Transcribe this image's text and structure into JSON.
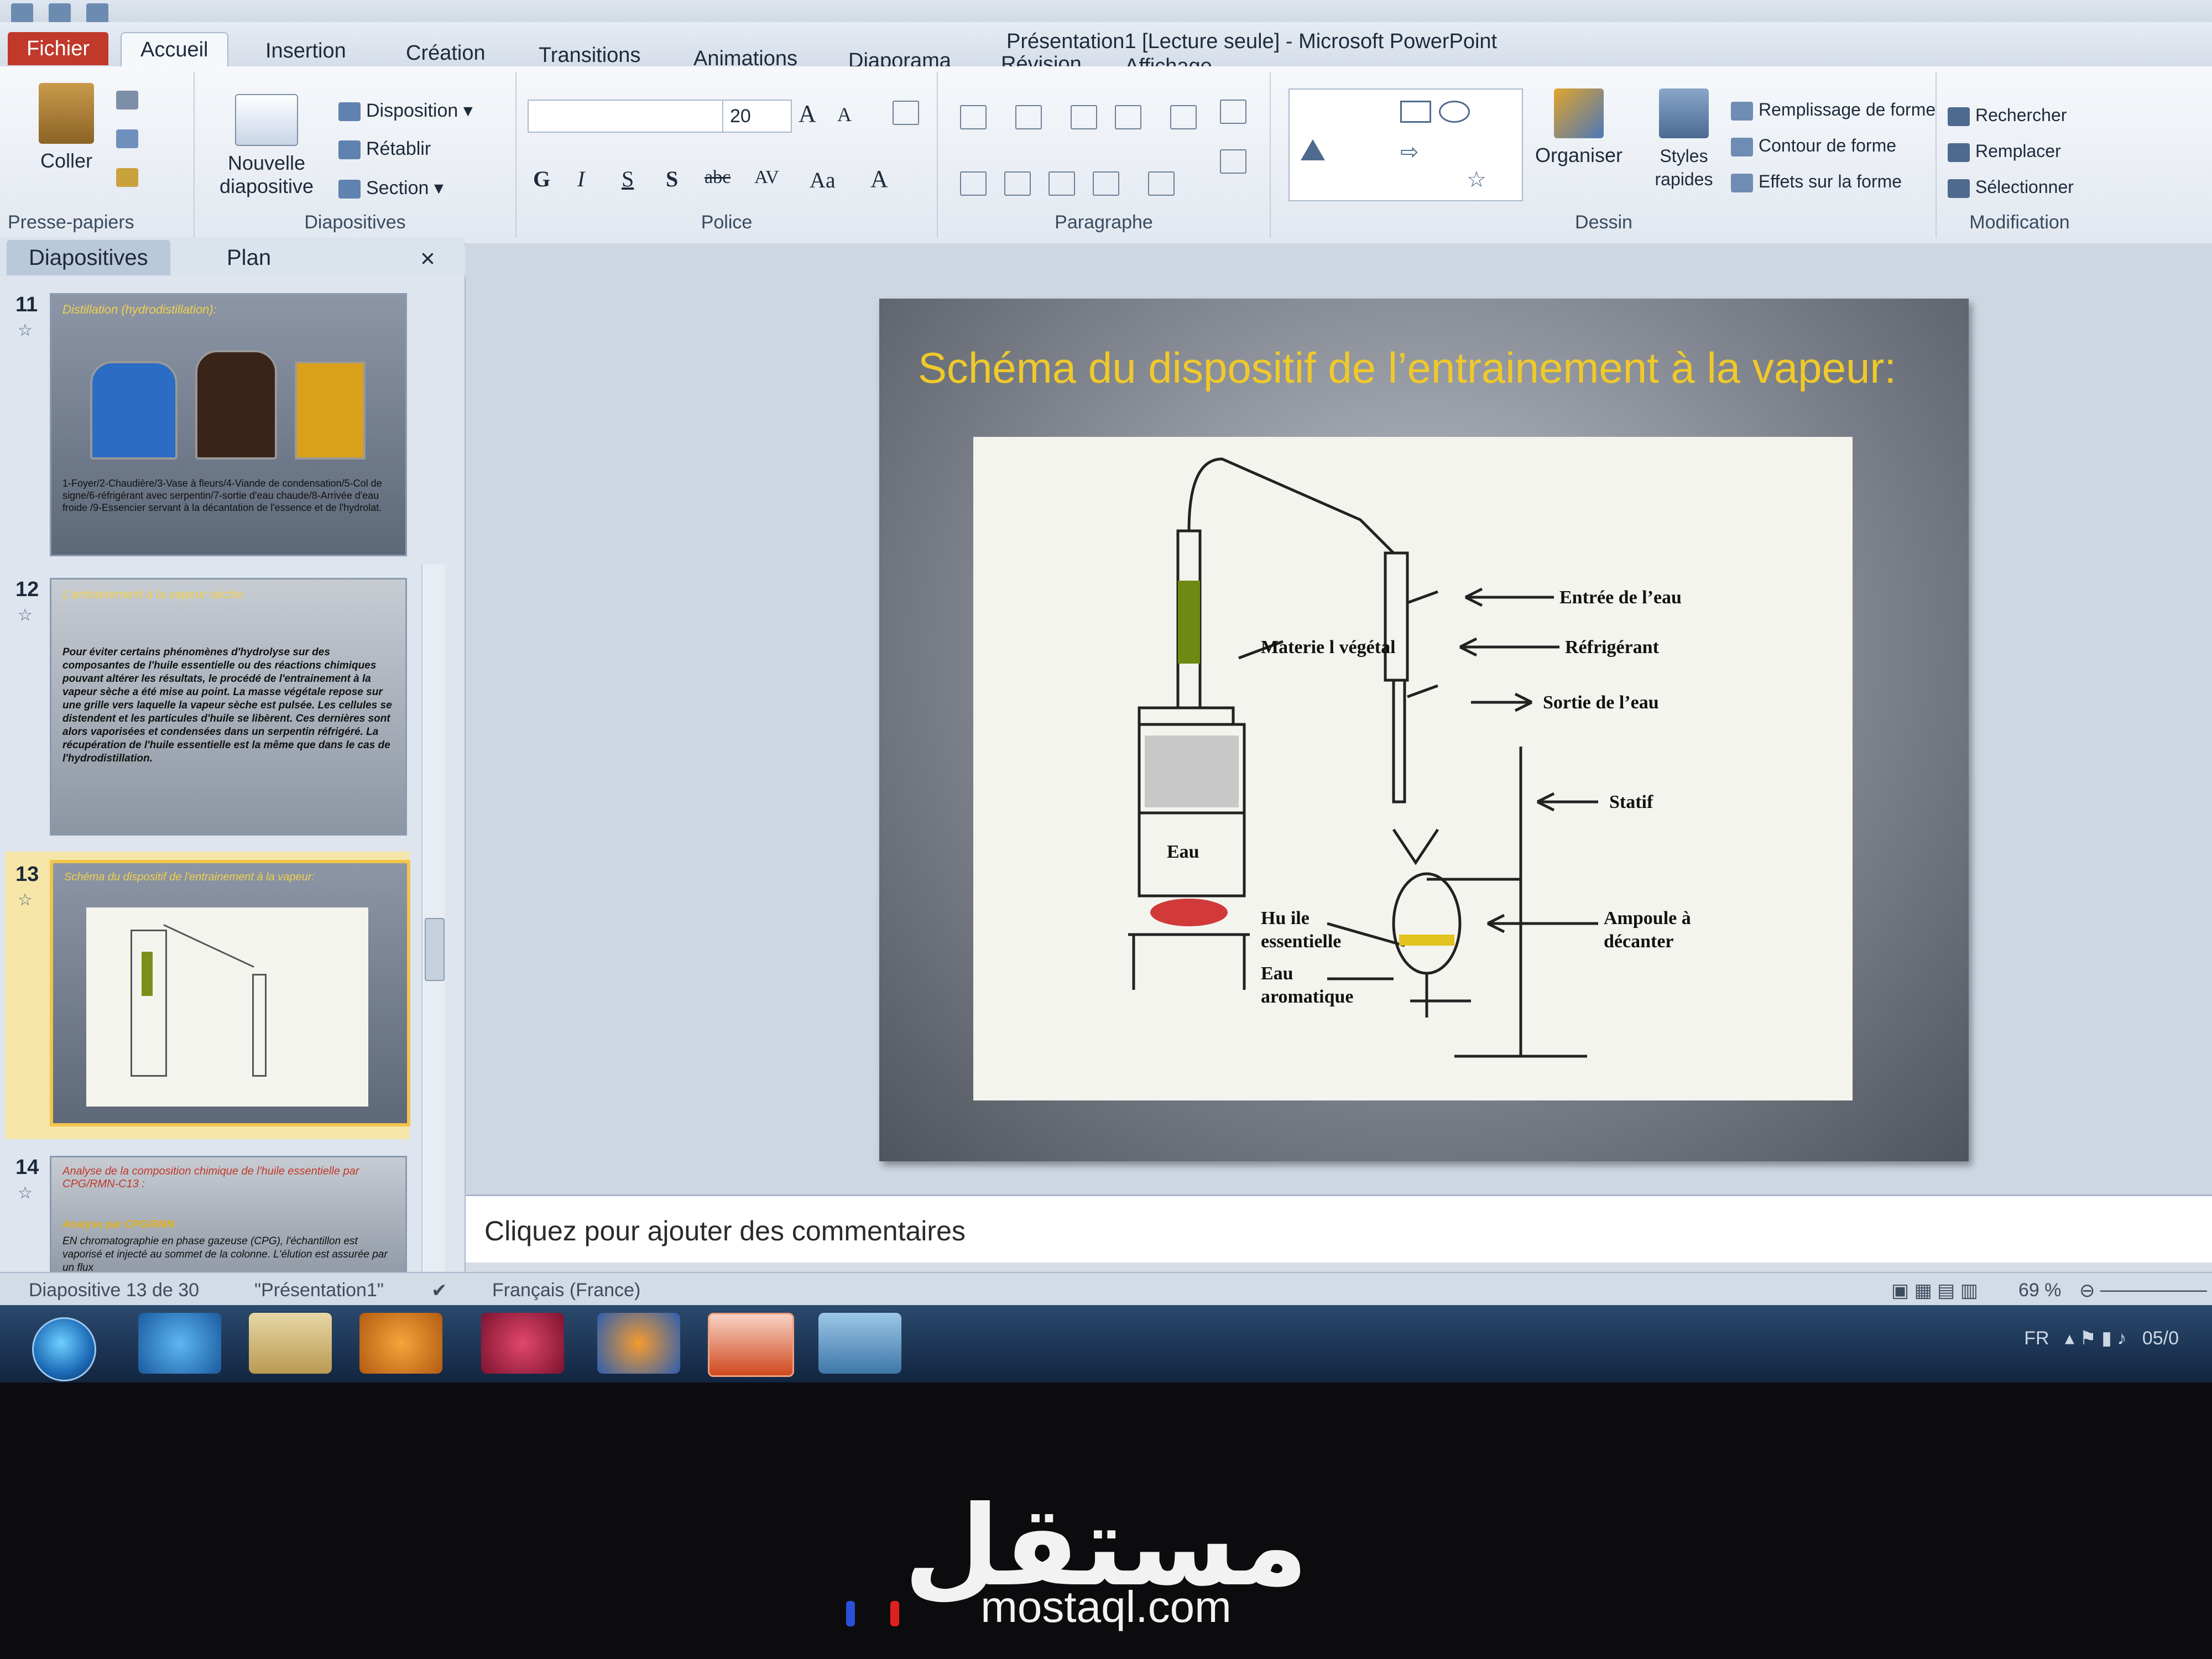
{
  "window": {
    "title": "Présentation1 [Lecture seule] - Microsoft PowerPoint"
  },
  "ribbon_tabs": [
    "Fichier",
    "Accueil",
    "Insertion",
    "Création",
    "Transitions",
    "Animations",
    "Diaporama",
    "Révision",
    "Affichage"
  ],
  "ribbon": {
    "clipboard": {
      "paste": "Coller",
      "label": "Presse-papiers"
    },
    "slides": {
      "new_slide": "Nouvelle diapositive",
      "layout": "Disposition",
      "reset": "Rétablir",
      "section": "Section",
      "label": "Diapositives"
    },
    "font": {
      "font_name": "",
      "font_size": "20",
      "bold": "G",
      "italic": "I",
      "underline": "S",
      "shadow": "S",
      "strike": "abc",
      "spacing": "AV",
      "case": "Aa",
      "color": "A",
      "label": "Police"
    },
    "paragraph": {
      "label": "Paragraphe"
    },
    "drawing": {
      "arrange": "Organiser",
      "quick_styles": "Styles rapides",
      "fill": "Remplissage de forme",
      "outline": "Contour de forme",
      "effects": "Effets sur la forme",
      "label": "Dessin"
    },
    "editing": {
      "find": "Rechercher",
      "replace": "Remplacer",
      "select": "Sélectionner",
      "label": "Modification"
    }
  },
  "pane": {
    "tabs": [
      "Diapositives",
      "Plan"
    ],
    "close": "×",
    "slides": [
      {
        "number": "11",
        "title": "Distillation (hydrodistillation):",
        "caption": "1-Foyer/2-Chaudière/3-Vase à fleurs/4-Viande de condensation/5-Col de signe/6-réfrigérant avec serpentin/7-sortie d'eau chaude/8-Arrivée d'eau froide /9-Essencier servant à la décantation de l'essence et de l'hydrolat."
      },
      {
        "number": "12",
        "title": "L'entrainement à la vapeur sèche:",
        "body": "Pour éviter certains phénomènes d'hydrolyse sur des composantes de l'huile essentielle ou des réactions chimiques pouvant altérer les résultats, le procédé de l'entrainement à la vapeur sèche a été mise au point. La masse végétale repose sur une grille vers laquelle la vapeur sèche est pulsée. Les cellules se distendent et les particules d'huile se libèrent. Ces dernières sont alors vaporisées et condensées dans un serpentin réfrigéré. La récupération de l'huile essentielle est la même que dans le cas de l'hydrodistillation."
      },
      {
        "number": "13",
        "title": "Schéma du dispositif de l'entrainement à la vapeur:"
      },
      {
        "number": "14",
        "title": "Analyse de la composition chimique de l'huile essentielle par CPG/RMN-C13 :",
        "subtitle": "Analyse par CPG/RMN",
        "body": "EN chromatographie en phase gazeuse (CPG), l'échantillon est vaporisé et injecté au sommet de la colonne. L'élution est assurée par un flux"
      }
    ]
  },
  "slide": {
    "title": "Schéma du dispositif de l’entrainement à la vapeur:",
    "labels": {
      "materiel": "Materie l végétal",
      "eau": "Eau",
      "entree": "Entrée de l’eau",
      "refrigerant": "Réfrigérant",
      "sortie": "Sortie de l’eau",
      "statif": "Statif",
      "huile": "Hu ile essentielle",
      "eau_aromatique": "Eau aromatique",
      "ampoule": "Ampoule à décanter"
    }
  },
  "notes": {
    "placeholder": "Cliquez pour ajouter des commentaires"
  },
  "status": {
    "slide_info": "Diapositive 13 de 30",
    "theme": "\"Présentation1\"",
    "language": "Français (France)",
    "zoom": "69 %"
  },
  "taskbar": {
    "lang": "FR",
    "date": "05/0"
  },
  "watermark": {
    "arabic": "مستقل",
    "latin": "mostaql.com"
  }
}
